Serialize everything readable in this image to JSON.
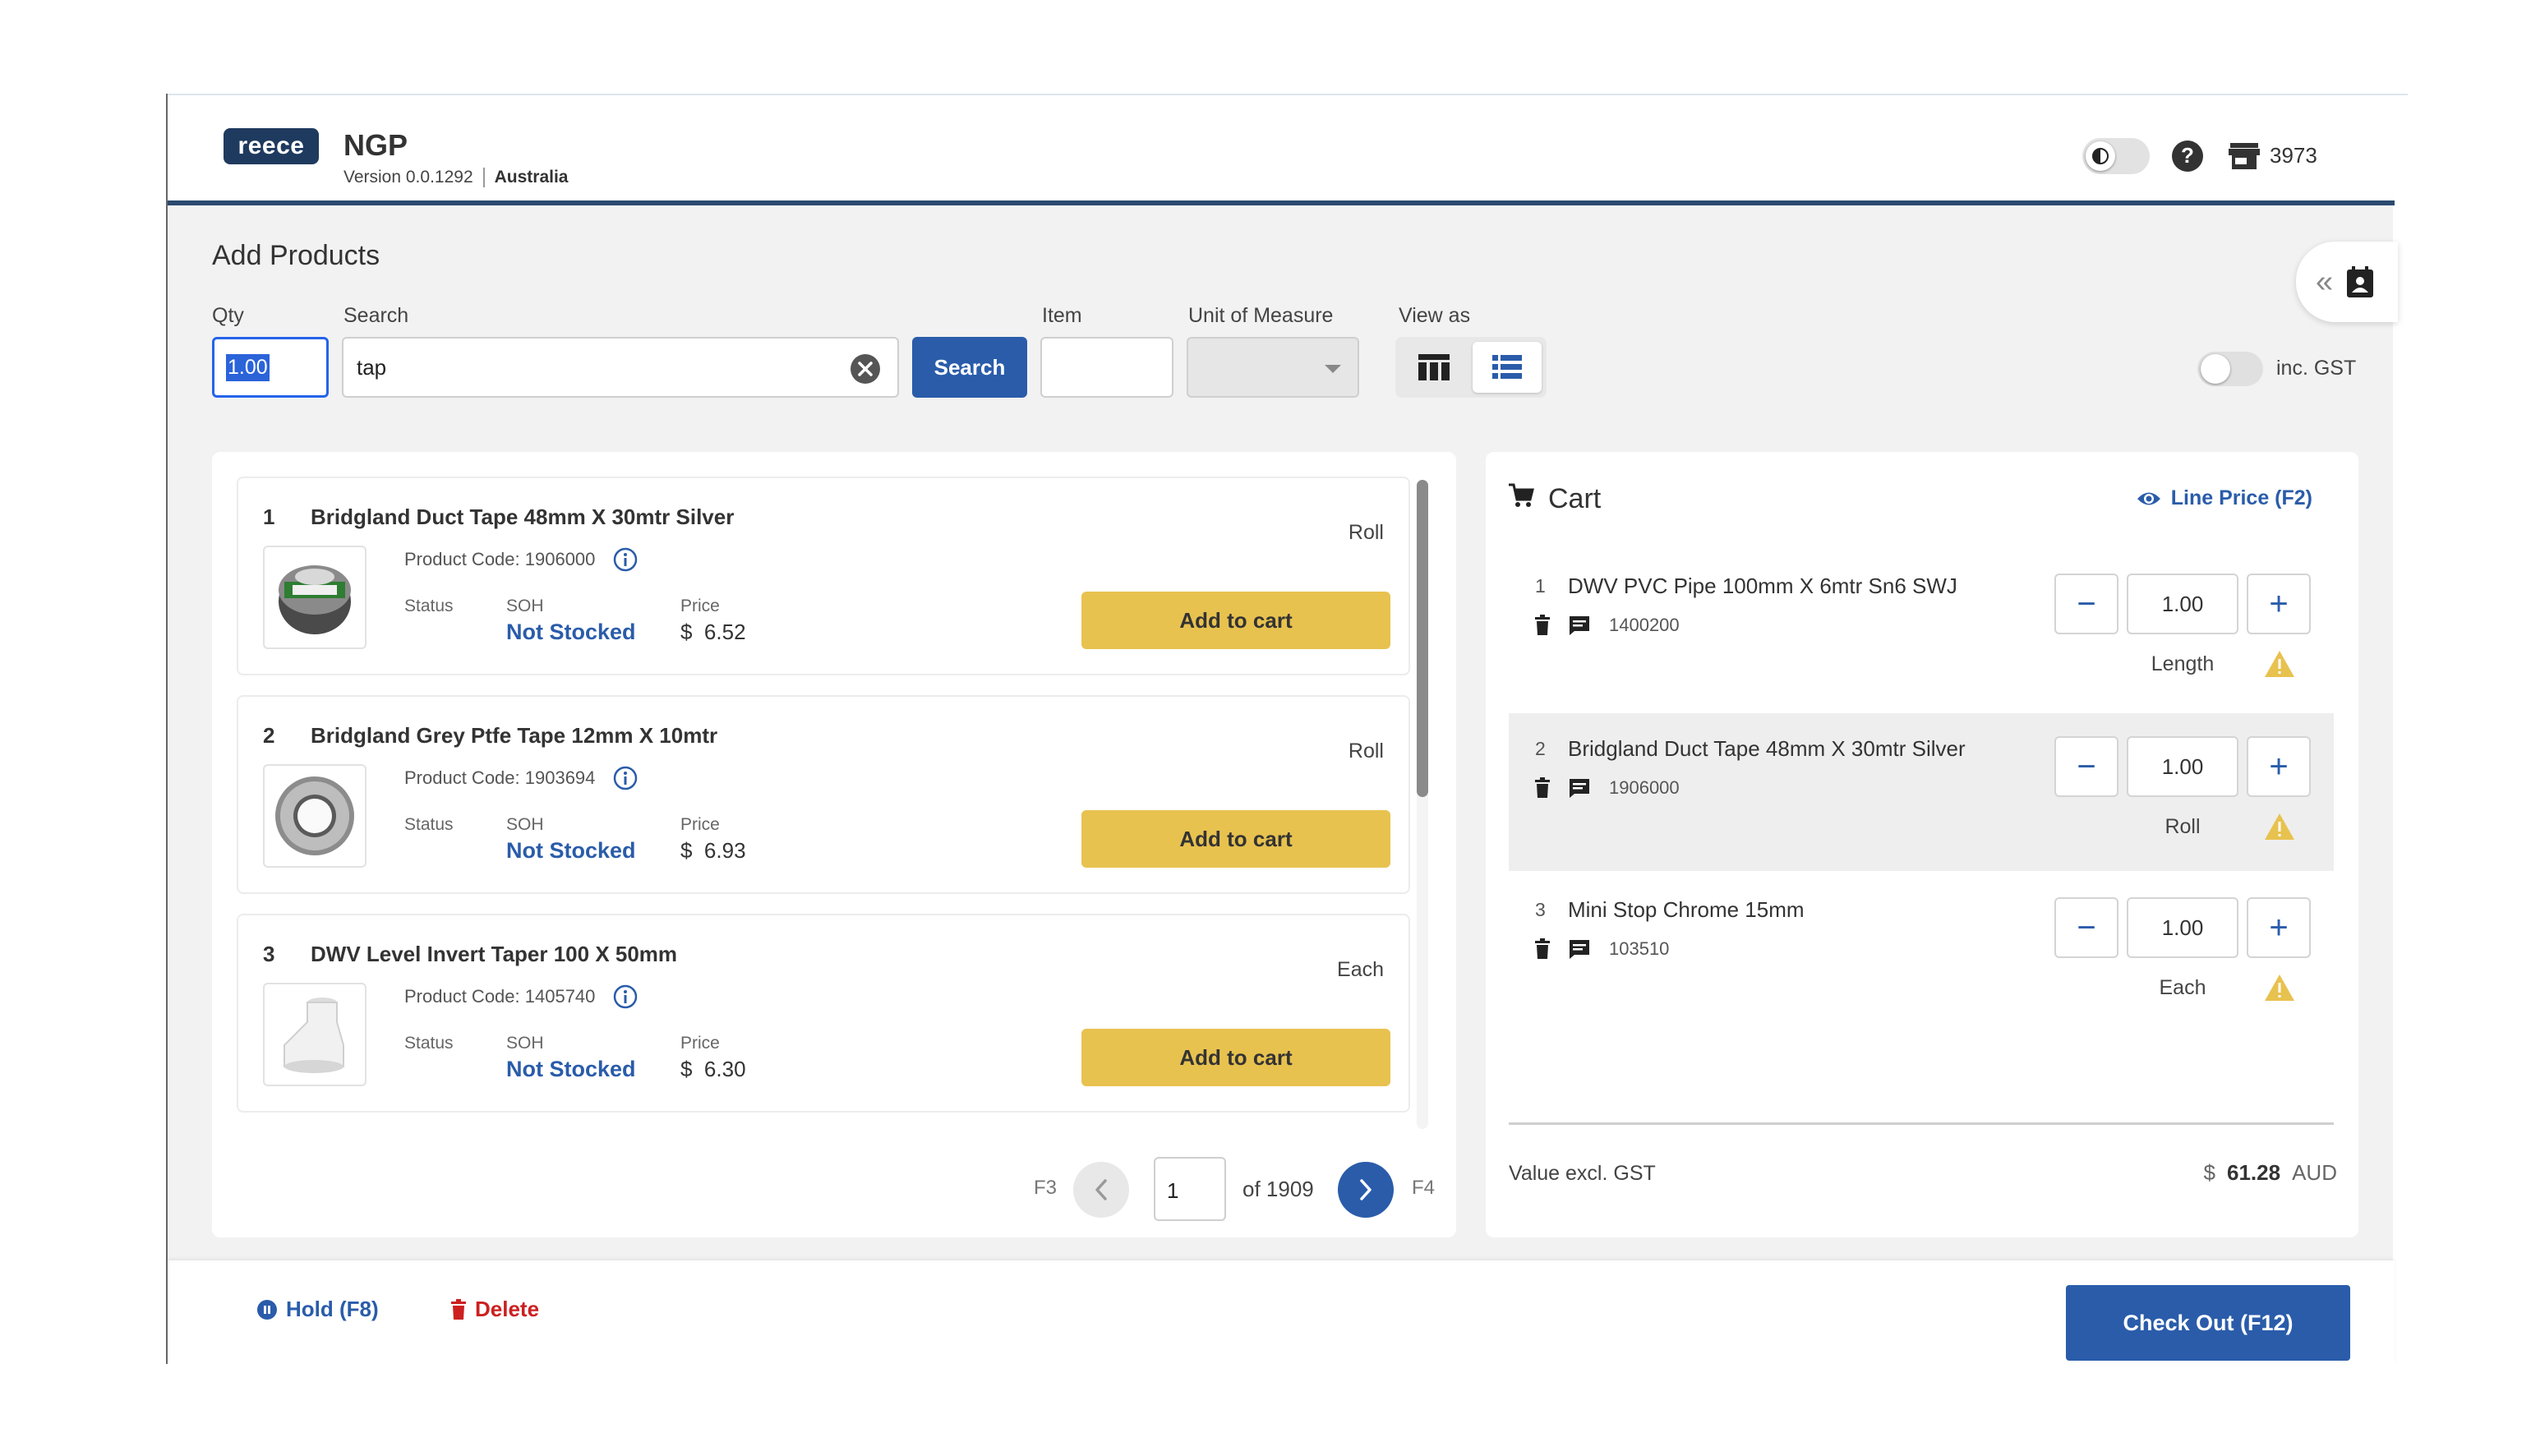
{
  "header": {
    "logo_text": "reece",
    "app_name": "NGP",
    "version": "Version 0.0.1292",
    "country": "Australia",
    "store_number": "3973",
    "icons": [
      "dark-mode-toggle",
      "help-icon",
      "store-icon"
    ]
  },
  "add_products": {
    "title": "Add Products",
    "qty_label": "Qty",
    "qty_value": "1.00",
    "search_label": "Search",
    "search_value": "tap",
    "search_button": "Search",
    "item_label": "Item",
    "item_value": "",
    "uom_label": "Unit of Measure",
    "uom_value": "",
    "view_label": "View as",
    "view_mode": "list",
    "gst_label": "inc. GST",
    "gst_enabled": false
  },
  "products": {
    "status_label": "Status",
    "soh_label": "SOH",
    "price_label": "Price",
    "currency": "$",
    "add_label": "Add to cart",
    "items": [
      {
        "index": "1",
        "name": "Bridgland Duct Tape 48mm X 30mtr Silver",
        "code": "Product Code: 1906000",
        "uom": "Roll",
        "soh": "Not Stocked",
        "price": "6.52"
      },
      {
        "index": "2",
        "name": "Bridgland Grey Ptfe Tape 12mm X 10mtr",
        "code": "Product Code: 1903694",
        "uom": "Roll",
        "soh": "Not Stocked",
        "price": "6.93"
      },
      {
        "index": "3",
        "name": "DWV Level Invert Taper 100 X 50mm",
        "code": "Product Code: 1405740",
        "uom": "Each",
        "soh": "Not Stocked",
        "price": "6.30"
      }
    ]
  },
  "pager": {
    "prev_key": "F3",
    "page": "1",
    "of_text": "of 1909",
    "next_key": "F4"
  },
  "cart": {
    "title": "Cart",
    "line_price": "Line Price (F2)",
    "items": [
      {
        "index": "1",
        "name": "DWV PVC Pipe 100mm X 6mtr Sn6 SWJ",
        "code": "1400200",
        "qty": "1.00",
        "uom": "Length"
      },
      {
        "index": "2",
        "name": "Bridgland Duct Tape 48mm X 30mtr Silver",
        "code": "1906000",
        "qty": "1.00",
        "uom": "Roll"
      },
      {
        "index": "3",
        "name": "Mini Stop Chrome 15mm",
        "code": "103510",
        "qty": "1.00",
        "uom": "Each"
      }
    ],
    "value_label": "Value excl. GST",
    "currency": "$",
    "value": "61.28",
    "currency_code": "AUD"
  },
  "footer": {
    "hold_label": "Hold (F8)",
    "delete_label": "Delete",
    "checkout_label": "Check Out (F12)"
  },
  "colors": {
    "primary": "#2a5caa",
    "accent_yellow": "#e8c24f",
    "danger": "#cc2020",
    "header_border": "#2b4a6f"
  }
}
